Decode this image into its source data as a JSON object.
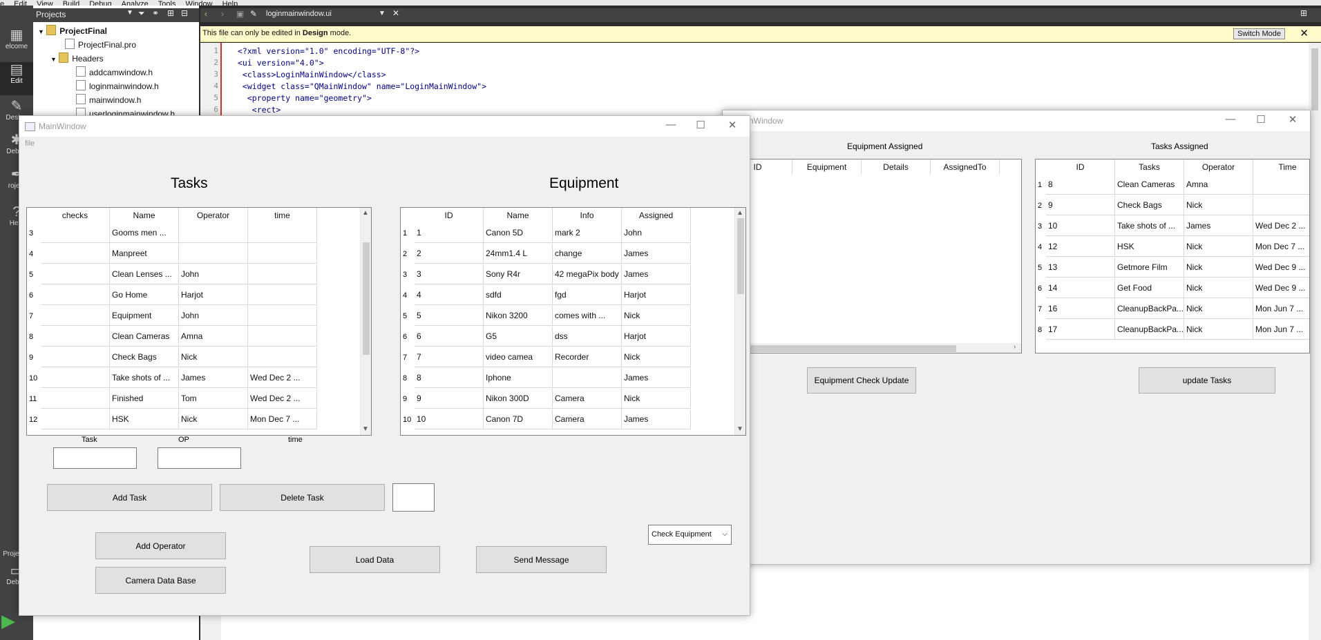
{
  "ide": {
    "menu": [
      "e",
      "Edit",
      "View",
      "Build",
      "Debug",
      "Analyze",
      "Tools",
      "Window",
      "Help"
    ],
    "modes": [
      "elcome",
      "Edit",
      "Design",
      "Debug",
      "roject",
      "Help"
    ],
    "bottom_label": "ProjectFi",
    "bottom_mode": "Debug",
    "projects_selector": "Projects",
    "tree": {
      "root": "ProjectFinal",
      "pro_file": "ProjectFinal.pro",
      "headers": "Headers",
      "files": [
        "addcamwindow.h",
        "loginmainwindow.h",
        "mainwindow.h",
        "userloginmainwindow.h"
      ]
    },
    "editor_tab": "loginmainwindow.ui",
    "info_bar_prefix": "This file can only be edited in ",
    "info_bar_bold": "Design",
    "info_bar_suffix": " mode.",
    "switch_mode": "Switch Mode",
    "code_lines": [
      "<?xml version=\"1.0\" encoding=\"UTF-8\"?>",
      "<ui version=\"4.0\">",
      " <class>LoginMainWindow</class>",
      " <widget class=\"QMainWindow\" name=\"LoginMainWindow\">",
      "  <property name=\"geometry\">",
      "   <rect>"
    ],
    "line_numbers": [
      "1",
      "2",
      "3",
      "4",
      "5",
      "6"
    ]
  },
  "window_left": {
    "title": "MainWindow",
    "menu_file": "file",
    "tasks_heading": "Tasks",
    "equipment_heading": "Equipment",
    "tasks_table": {
      "headers": [
        "checks",
        "Name",
        "Operator",
        "time"
      ],
      "rows": [
        [
          "3",
          "",
          "Gooms men ...",
          "",
          ""
        ],
        [
          "4",
          "",
          "Manpreet",
          "",
          ""
        ],
        [
          "5",
          "",
          "Clean Lenses ...",
          "John",
          ""
        ],
        [
          "6",
          "",
          "Go Home",
          "Harjot",
          ""
        ],
        [
          "7",
          "",
          "Equipment",
          "John",
          ""
        ],
        [
          "8",
          "",
          "Clean Cameras",
          "Amna",
          ""
        ],
        [
          "9",
          "",
          "Check Bags",
          "Nick",
          ""
        ],
        [
          "10",
          "",
          "Take shots of ...",
          "James",
          "Wed Dec 2 ..."
        ],
        [
          "11",
          "",
          "Finished",
          "Tom",
          "Wed Dec 2 ..."
        ],
        [
          "12",
          "",
          "HSK",
          "Nick",
          "Mon Dec 7 ..."
        ]
      ]
    },
    "equipment_table": {
      "headers": [
        "ID",
        "Name",
        "Info",
        "Assigned"
      ],
      "rows": [
        [
          "1",
          "1",
          "Canon 5D",
          "mark 2",
          "John"
        ],
        [
          "2",
          "2",
          "24mm1.4 L",
          "change",
          "James"
        ],
        [
          "3",
          "3",
          "Sony R4r",
          "42 megaPix body",
          "James"
        ],
        [
          "4",
          "4",
          "sdfd",
          "fgd",
          "Harjot"
        ],
        [
          "5",
          "5",
          "Nikon 3200",
          "comes with ...",
          "Nick"
        ],
        [
          "6",
          "6",
          "G5",
          "dss",
          "Harjot"
        ],
        [
          "7",
          "7",
          "video camea",
          "Recorder",
          "Nick"
        ],
        [
          "8",
          "8",
          "Iphone",
          "",
          "James"
        ],
        [
          "9",
          "9",
          "Nikon 300D",
          "Camera",
          "Nick"
        ],
        [
          "10",
          "10",
          "Canon 7D",
          "Camera",
          "James"
        ]
      ]
    },
    "labels": {
      "task": "Task",
      "op": "OP",
      "time": "time"
    },
    "buttons": {
      "add_task": "Add Task",
      "delete_task": "Delete Task",
      "add_operator": "Add Operator",
      "camera_db": "Camera Data Base",
      "load_data": "Load Data",
      "send_message": "Send Message"
    },
    "check_equipment": "Check Equipment"
  },
  "window_right": {
    "title": "nWindow",
    "equipment_assigned": "Equipment Assigned",
    "tasks_assigned": "Tasks Assigned",
    "equip_headers": [
      "ID",
      "Equipment",
      "Details",
      "AssignedTo"
    ],
    "tasks_headers": [
      "ID",
      "Tasks",
      "Operator",
      "Time"
    ],
    "tasks_rows": [
      [
        "1",
        "8",
        "Clean Cameras",
        "Amna",
        ""
      ],
      [
        "2",
        "9",
        "Check Bags",
        "Nick",
        ""
      ],
      [
        "3",
        "10",
        "Take shots of ...",
        "James",
        "Wed Dec 2 ..."
      ],
      [
        "4",
        "12",
        "HSK",
        "Nick",
        "Mon Dec 7 ..."
      ],
      [
        "5",
        "13",
        "Getmore Film",
        "Nick",
        "Wed Dec 9 ..."
      ],
      [
        "6",
        "14",
        "Get Food",
        "Nick",
        "Wed Dec 9 ..."
      ],
      [
        "7",
        "16",
        "CleanupBackPa...",
        "Nick",
        "Mon Jun 7 ..."
      ],
      [
        "8",
        "17",
        "CleanupBackPa...",
        "Nick",
        "Mon Jun 7 ..."
      ]
    ],
    "buttons": {
      "equipment_check_update": "Equipment Check Update",
      "update_tasks": "update Tasks"
    }
  }
}
